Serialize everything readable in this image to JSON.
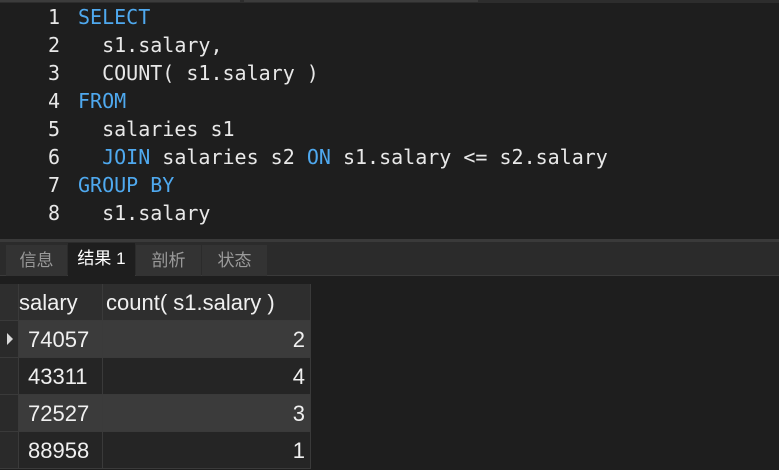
{
  "editor": {
    "lines": [
      {
        "num": "1",
        "segments": [
          {
            "text": "SELECT",
            "kw": true
          }
        ]
      },
      {
        "num": "2",
        "segments": [
          {
            "text": "  s1.salary,",
            "kw": false
          }
        ]
      },
      {
        "num": "3",
        "segments": [
          {
            "text": "  COUNT( s1.salary )",
            "kw": false
          }
        ]
      },
      {
        "num": "4",
        "segments": [
          {
            "text": "FROM",
            "kw": true
          }
        ]
      },
      {
        "num": "5",
        "segments": [
          {
            "text": "  salaries s1",
            "kw": false
          }
        ]
      },
      {
        "num": "6",
        "segments": [
          {
            "text": "  ",
            "kw": false
          },
          {
            "text": "JOIN",
            "kw": true
          },
          {
            "text": " salaries s2 ",
            "kw": false
          },
          {
            "text": "ON",
            "kw": true
          },
          {
            "text": " s1.salary <= s2.salary",
            "kw": false
          }
        ]
      },
      {
        "num": "7",
        "segments": [
          {
            "text": "GROUP BY",
            "kw": true
          }
        ]
      },
      {
        "num": "8",
        "segments": [
          {
            "text": "  s1.salary",
            "kw": false
          }
        ]
      }
    ]
  },
  "tabs": [
    {
      "label": "信息",
      "active": false
    },
    {
      "label": "结果 1",
      "active": true
    },
    {
      "label": "剖析",
      "active": false
    },
    {
      "label": "状态",
      "active": false
    }
  ],
  "result": {
    "columns": [
      "salary",
      "count( s1.salary )"
    ],
    "rows": [
      [
        "74057",
        "2"
      ],
      [
        "43311",
        "4"
      ],
      [
        "72527",
        "3"
      ],
      [
        "88958",
        "1"
      ]
    ]
  },
  "colors": {
    "keyword": "#4fa9ef",
    "editor_bg": "#1e1e1e",
    "text": "#e8e8e8"
  }
}
